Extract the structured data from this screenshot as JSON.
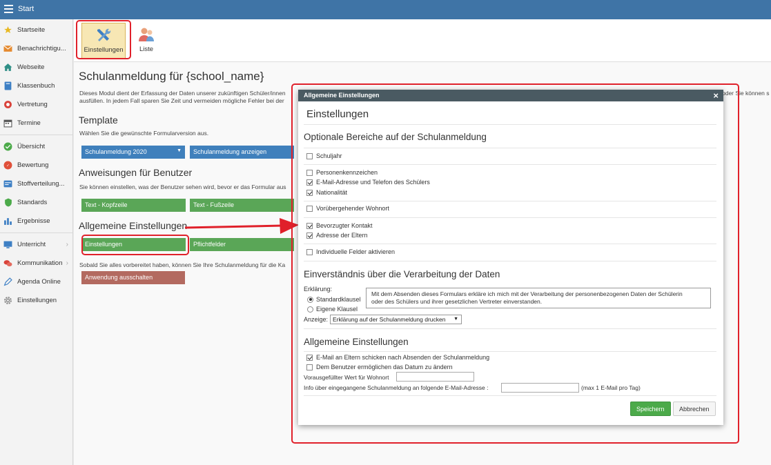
{
  "topbar": {
    "title": "Start"
  },
  "sidebar": {
    "items": [
      {
        "label": "Startseite",
        "icon": "star-icon"
      },
      {
        "label": "Benachrichtigu...",
        "icon": "envelope-icon"
      },
      {
        "label": "Webseite",
        "icon": "home-icon"
      },
      {
        "label": "Klassenbuch",
        "icon": "book-icon"
      },
      {
        "label": "Vertretung",
        "icon": "lifebuoy-icon"
      },
      {
        "label": "Termine",
        "icon": "calendar-icon"
      },
      {
        "label": "Übersicht",
        "icon": "check-circle-icon"
      },
      {
        "label": "Bewertung",
        "icon": "grade-icon"
      },
      {
        "label": "Stoffverteilung...",
        "icon": "card-icon"
      },
      {
        "label": "Standards",
        "icon": "shield-icon"
      },
      {
        "label": "Ergebnisse",
        "icon": "bar-chart-icon"
      },
      {
        "label": "Unterricht",
        "icon": "monitor-icon"
      },
      {
        "label": "Kommunikation",
        "icon": "chat-icon"
      },
      {
        "label": "Agenda Online",
        "icon": "pen-icon"
      },
      {
        "label": "Einstellungen",
        "icon": "gear-icon"
      }
    ]
  },
  "toolbar": {
    "settings_label": "Einstellungen",
    "list_label": "Liste"
  },
  "main": {
    "title": "Schulanmeldung für {school_name}",
    "intro_line1": "Dieses Modul dient der Erfassung der Daten unserer zukünftigen Schüler/innen",
    "intro_line2": "ausfüllen. In jedem Fall sparen Sie Zeit und vermeiden mögliche Fehler bei der",
    "intro_right": "oder Sie können s",
    "template_heading": "Template",
    "template_desc": "Wählen Sie die gewünschte Formularversion aus.",
    "template_select": "Schulanmeldung 2020",
    "show_button": "Schulanmeldung anzeigen",
    "instructions_heading": "Anweisungen für Benutzer",
    "instructions_desc": "Sie können einstellen, was der Benutzer sehen wird, bevor er das Formular aus",
    "header_button": "Text - Kopfzeile",
    "footer_button": "Text - Fußzeile",
    "general_heading": "Allgemeine Einstellungen",
    "settings_button": "Einstellungen",
    "required_button": "Pflichtfelder",
    "ready_text": "Sobald Sie alles vorbereitet haben, können Sie Ihre Schulanmeldung für die Ka",
    "disable_button": "Anwendung ausschalten"
  },
  "modal": {
    "header_title": "Allgemeine Einstellungen",
    "close_symbol": "×",
    "title": "Einstellungen",
    "optional_heading": "Optionale Bereiche auf der Schulanmeldung",
    "checkboxes": [
      {
        "label": "Schuljahr",
        "checked": false
      },
      {
        "label": "Personenkennzeichen",
        "checked": false
      },
      {
        "label": "E-Mail-Adresse und Telefon des Schülers",
        "checked": true
      },
      {
        "label": "Nationalität",
        "checked": true
      },
      {
        "label": "Vorübergehender Wohnort",
        "checked": false
      },
      {
        "label": "Bevorzugter Kontakt",
        "checked": true
      },
      {
        "label": "Adresse der Eltern",
        "checked": true
      },
      {
        "label": "Individuelle Felder aktivieren",
        "checked": false
      }
    ],
    "consent_heading": "Einverständnis über die Verarbeitung der Daten",
    "declaration_label": "Erklärung:",
    "radio_standard": "Standardklausel",
    "radio_own": "Eigene Klausel",
    "consent_text_line1": "Mit dem Absenden dieses Formulars erkläre ich mich mit der Verarbeitung der personenbezogenen Daten der Schülerin",
    "consent_text_line2": "oder des Schülers und ihrer gesetzlichen Vertreter einverstanden.",
    "display_label": "Anzeige:",
    "display_select": "Erklärung auf der Schulanmeldung drucken",
    "general_heading": "Allgemeine Einstellungen",
    "general_checkboxes": [
      {
        "label": "E-Mail an Eltern schicken nach Absenden der Schulanmeldung",
        "checked": true
      },
      {
        "label": "Dem Benutzer ermöglichen das Datum zu ändern",
        "checked": false
      }
    ],
    "residence_label": "Vorausgefüllter Wert für Wohnort",
    "residence_value": "",
    "email_info_label": "Info über eingegangene Schulanmeldung an folgende E-Mail-Adresse :",
    "email_info_value": "",
    "email_info_hint": "(max 1 E-Mail pro Tag)",
    "save_button": "Speichern",
    "cancel_button": "Abbrechen"
  },
  "colors": {
    "topbar": "#3f74a6",
    "highlight": "#e0202a",
    "green": "#5aa657",
    "blue": "#3f80bc",
    "brown": "#b36a60"
  }
}
